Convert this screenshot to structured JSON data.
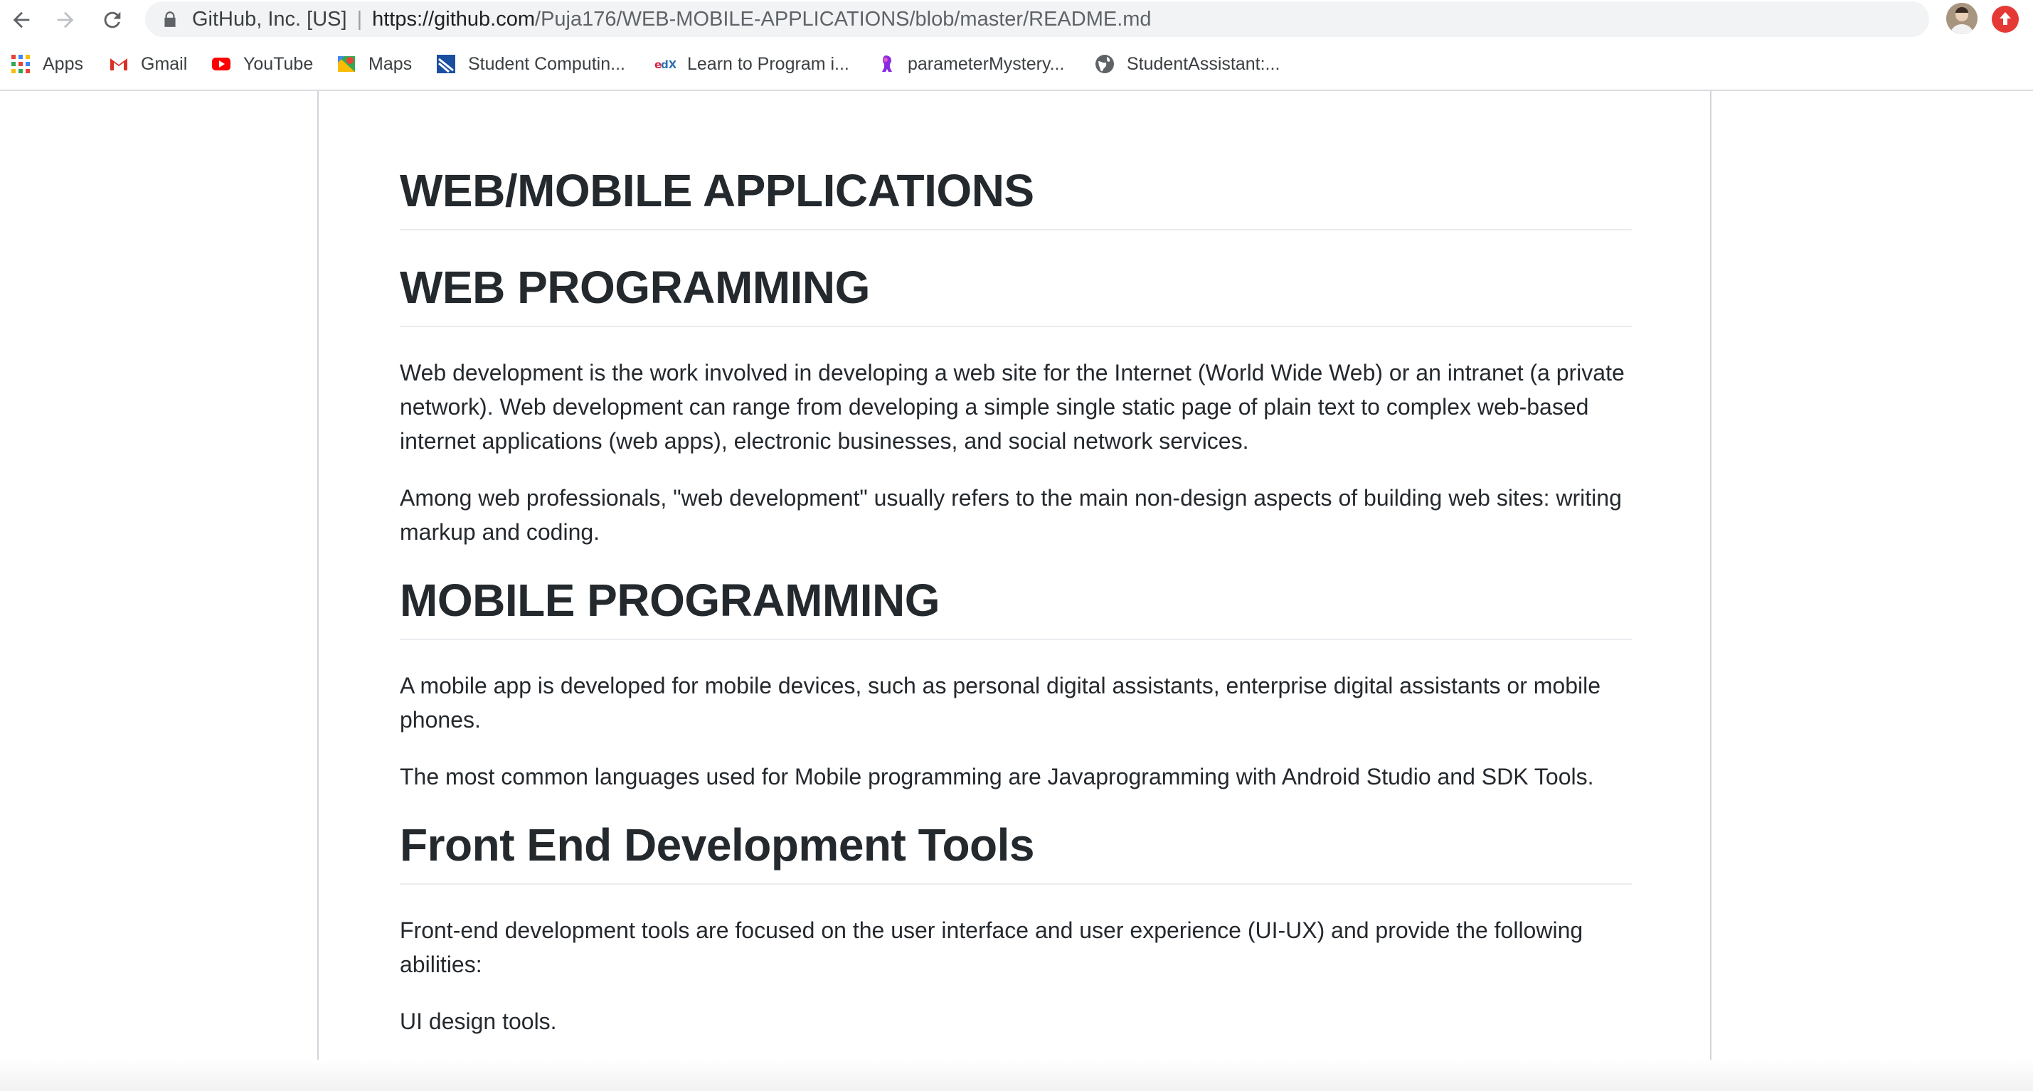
{
  "browser": {
    "site_identity": "GitHub, Inc. [US]",
    "url_scheme_host": "https://github.com",
    "url_path": "/Puja176/WEB-MOBILE-APPLICATIONS/blob/master/README.md"
  },
  "bookmarks": [
    {
      "label": "Apps",
      "icon": "apps-grid-icon"
    },
    {
      "label": "Gmail",
      "icon": "gmail-icon"
    },
    {
      "label": "YouTube",
      "icon": "youtube-icon"
    },
    {
      "label": "Maps",
      "icon": "maps-icon"
    },
    {
      "label": "Student Computin...",
      "icon": "student-computing-icon"
    },
    {
      "label": "Learn to Program i...",
      "icon": "edx-icon"
    },
    {
      "label": "parameterMystery...",
      "icon": "mystery-icon"
    },
    {
      "label": "StudentAssistant:...",
      "icon": "globe-icon"
    }
  ],
  "article": {
    "title": "WEB/MOBILE APPLICATIONS",
    "sections": [
      {
        "heading": "WEB PROGRAMMING",
        "paragraphs": [
          "Web development is the work involved in developing a web site for the Internet (World Wide Web) or an intranet (a private network). Web development can range from developing a simple single static page of plain text to complex web-based internet applications (web apps), electronic businesses, and social network services.",
          "Among web professionals, \"web development\" usually refers to the main non-design aspects of building web sites: writing markup and coding."
        ]
      },
      {
        "heading": "MOBILE PROGRAMMING",
        "paragraphs": [
          "A mobile app is developed for mobile devices, such as personal digital assistants, enterprise digital assistants or mobile phones.",
          "The most common languages used for Mobile programming are Javaprogramming with Android Studio and SDK Tools."
        ]
      },
      {
        "heading": "Front End Development Tools",
        "paragraphs": [
          "Front-end development tools are focused on the user interface and user experience (UI-UX) and provide the following abilities:",
          "UI design tools."
        ]
      }
    ]
  },
  "colors": {
    "text": "#24292e",
    "heading_rule": "#eaecef",
    "omnibox_bg": "#f1f3f4"
  }
}
